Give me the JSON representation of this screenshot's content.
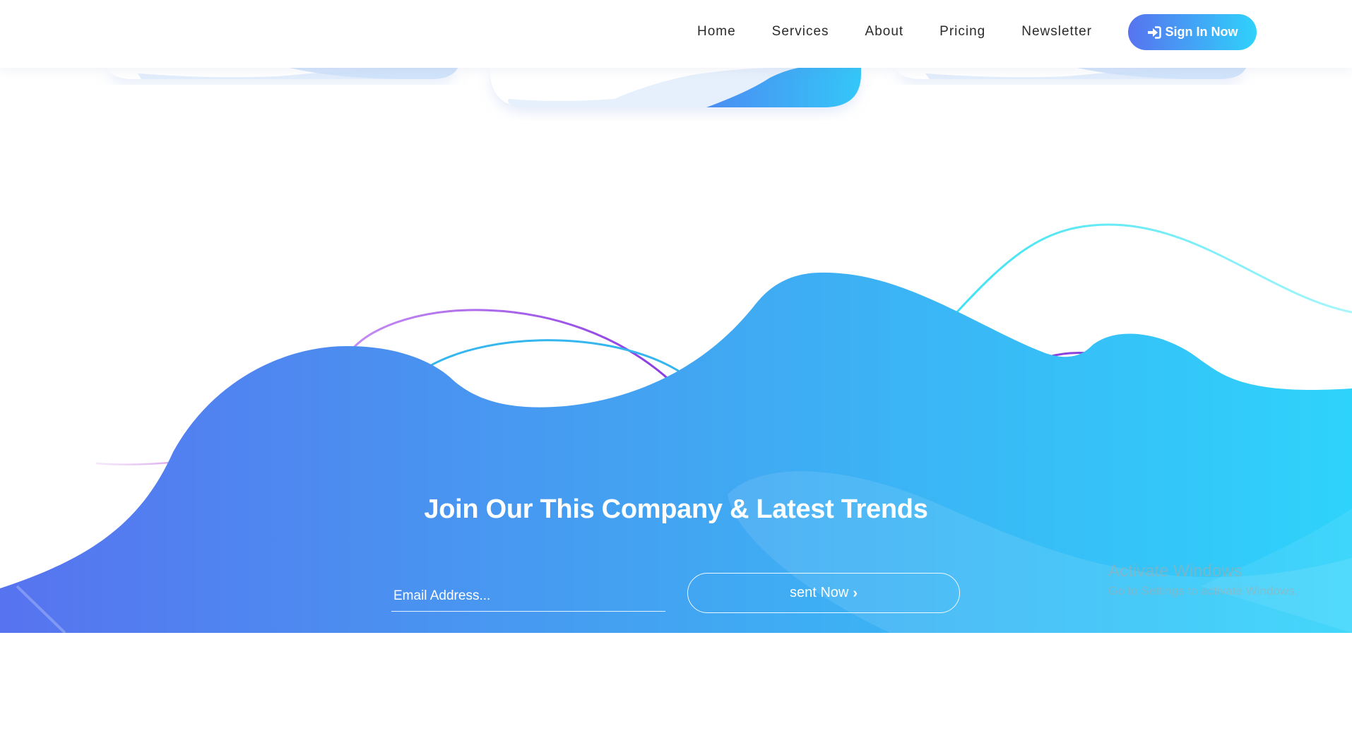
{
  "nav": {
    "items": [
      {
        "label": "Home"
      },
      {
        "label": "Services"
      },
      {
        "label": "About"
      },
      {
        "label": "Pricing"
      },
      {
        "label": "Newsletter"
      }
    ],
    "signin": {
      "label": "Sign In Now",
      "icon": "sign-in-icon"
    }
  },
  "newsletter": {
    "title": "Join Our This Company & Latest Trends",
    "email_placeholder": "Email Address...",
    "email_value": "",
    "send_label": "sent Now",
    "send_icon": "chevron-right-icon"
  },
  "watermark": {
    "title": "Activate Windows",
    "subtitle": "Go to Settings to activate Windows."
  },
  "colors": {
    "gradient_start": "#5773ef",
    "gradient_end": "#2fd2fb",
    "nav_text": "#2a2a2a",
    "curve_purple": "#a64ce6",
    "curve_blue": "#3cbcf0",
    "curve_cyan": "#5fecf4"
  }
}
